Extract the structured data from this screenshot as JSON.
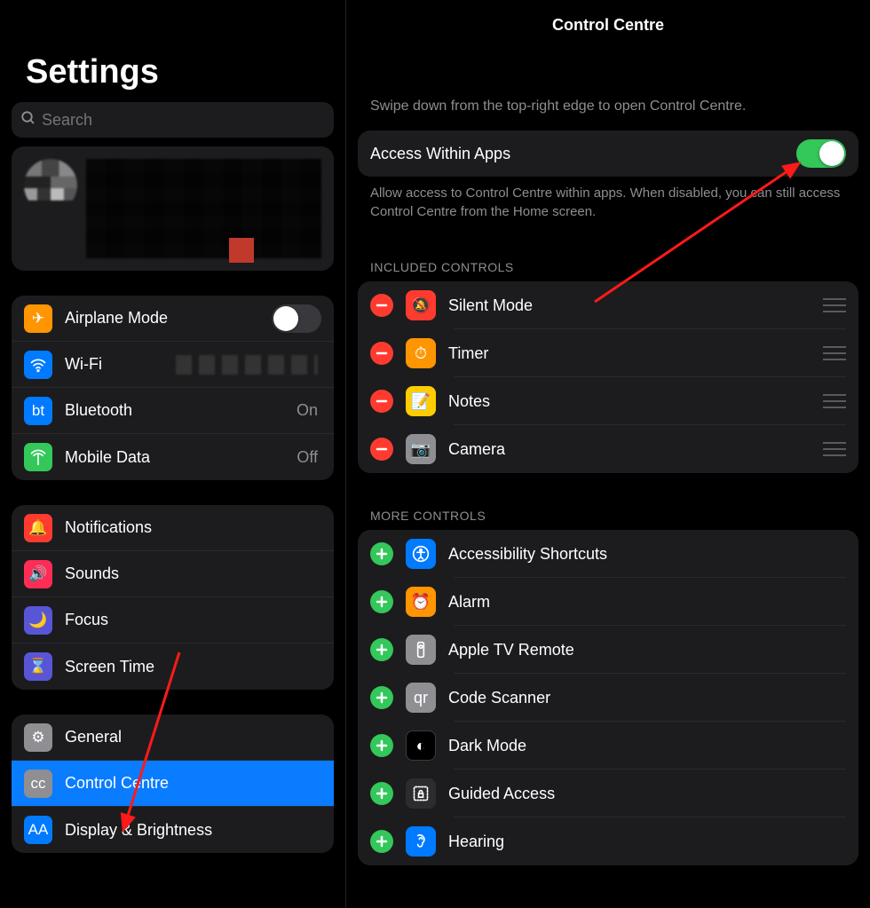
{
  "sidebar": {
    "title": "Settings",
    "search_placeholder": "Search",
    "groups": [
      [
        {
          "icon": "✈",
          "bg": "bg-orange",
          "name": "airplane-mode",
          "label": "Airplane Mode",
          "type": "switch",
          "on": false
        },
        {
          "icon": "wifi",
          "bg": "bg-blue",
          "name": "wifi",
          "label": "Wi-Fi",
          "type": "wifi-blur"
        },
        {
          "icon": "bt",
          "bg": "bg-blue",
          "name": "bluetooth",
          "label": "Bluetooth",
          "type": "value",
          "value": "On"
        },
        {
          "icon": "ant",
          "bg": "bg-green",
          "name": "mobile-data",
          "label": "Mobile Data",
          "type": "value",
          "value": "Off"
        }
      ],
      [
        {
          "icon": "🔔",
          "bg": "bg-red",
          "name": "notifications",
          "label": "Notifications",
          "type": "nav"
        },
        {
          "icon": "🔊",
          "bg": "bg-pink",
          "name": "sounds",
          "label": "Sounds",
          "type": "nav"
        },
        {
          "icon": "🌙",
          "bg": "bg-indigo",
          "name": "focus",
          "label": "Focus",
          "type": "nav"
        },
        {
          "icon": "⌛",
          "bg": "bg-indigo",
          "name": "screen-time",
          "label": "Screen Time",
          "type": "nav"
        }
      ],
      [
        {
          "icon": "⚙",
          "bg": "bg-grey",
          "name": "general",
          "label": "General",
          "type": "nav"
        },
        {
          "icon": "cc",
          "bg": "bg-grey",
          "name": "control-centre",
          "label": "Control Centre",
          "type": "nav",
          "selected": true
        },
        {
          "icon": "AA",
          "bg": "bg-blue",
          "name": "display-brightness",
          "label": "Display & Brightness",
          "type": "nav"
        }
      ]
    ]
  },
  "main": {
    "title": "Control Centre",
    "hint": "Swipe down from the top-right edge to open Control Centre.",
    "access": {
      "label": "Access Within Apps",
      "on": true
    },
    "access_footer": "Allow access to Control Centre within apps. When disabled, you can still access Control Centre from the Home screen.",
    "included_hdr": "INCLUDED CONTROLS",
    "included": [
      {
        "icon": "🔕",
        "bg": "bg-red",
        "name": "silent-mode",
        "label": "Silent Mode"
      },
      {
        "icon": "⏱",
        "bg": "bg-orange",
        "name": "timer",
        "label": "Timer"
      },
      {
        "icon": "📝",
        "bg": "bg-yellow",
        "name": "notes",
        "label": "Notes"
      },
      {
        "icon": "📷",
        "bg": "bg-grey",
        "name": "camera",
        "label": "Camera"
      }
    ],
    "more_hdr": "MORE CONTROLS",
    "more": [
      {
        "icon": "acc",
        "bg": "bg-blue",
        "name": "accessibility-shortcuts",
        "label": "Accessibility Shortcuts"
      },
      {
        "icon": "⏰",
        "bg": "bg-orange",
        "name": "alarm",
        "label": "Alarm"
      },
      {
        "icon": "tvr",
        "bg": "bg-grey",
        "name": "apple-tv-remote",
        "label": "Apple TV Remote"
      },
      {
        "icon": "qr",
        "bg": "bg-grey",
        "name": "code-scanner",
        "label": "Code Scanner"
      },
      {
        "icon": "◐",
        "bg": "bg-black",
        "name": "dark-mode",
        "label": "Dark Mode"
      },
      {
        "icon": "lock",
        "bg": "bg-dark",
        "name": "guided-access",
        "label": "Guided Access"
      },
      {
        "icon": "ear",
        "bg": "bg-blue",
        "name": "hearing",
        "label": "Hearing"
      }
    ]
  }
}
